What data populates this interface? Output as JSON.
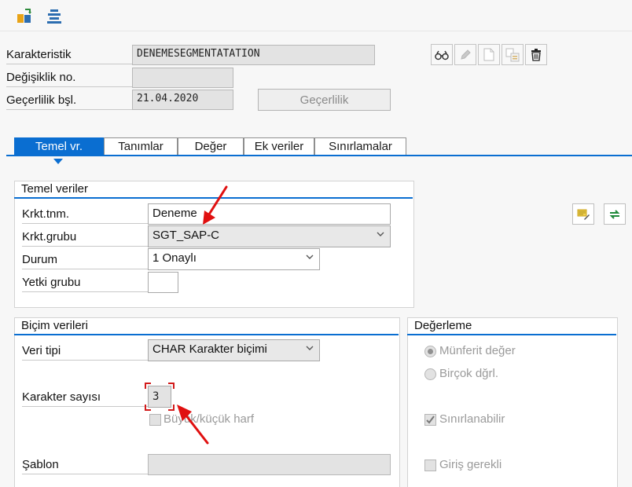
{
  "icons": {
    "toolbar": [
      "change-display-icon",
      "hierarchy-icon"
    ],
    "header_actions": [
      "display-icon",
      "edit-icon",
      "new-document-icon",
      "copy-icon",
      "delete-icon"
    ],
    "side": [
      "notes-icon",
      "refresh-icon"
    ]
  },
  "header": {
    "char_label": "Karakteristik",
    "char_value": "DENEMESEGMENTATATION",
    "change_no_label": "Değişiklik no.",
    "change_no_value": "",
    "valid_from_label": "Geçerlilik bşl.",
    "valid_from_value": "21.04.2020",
    "validity_button": "Geçerlilik"
  },
  "tabs": [
    {
      "label": "Temel vr.",
      "active": true
    },
    {
      "label": "Tanımlar",
      "active": false
    },
    {
      "label": "Değer",
      "active": false
    },
    {
      "label": "Ek veriler",
      "active": false
    },
    {
      "label": "Sınırlamalar",
      "active": false
    }
  ],
  "basic_data": {
    "title": "Temel veriler",
    "description_label": "Krkt.tnm.",
    "description_value": "Deneme",
    "group_label": "Krkt.grubu",
    "group_value": "SGT_SAP-C",
    "status_label": "Durum",
    "status_value": "1 Onaylı",
    "auth_group_label": "Yetki grubu",
    "auth_group_value": ""
  },
  "format_data": {
    "title": "Biçim verileri",
    "data_type_label": "Veri tipi",
    "data_type_value": "CHAR Karakter biçimi",
    "num_chars_label": "Karakter sayısı",
    "num_chars_value": "3",
    "case_sensitive_label": "Büyük/küçük harf",
    "case_sensitive_checked": false,
    "template_label": "Şablon",
    "template_value": ""
  },
  "value_assignment": {
    "title": "Değerleme",
    "single_value_label": "Münferit değer",
    "single_value_selected": true,
    "multiple_values_label": "Birçok dğrl.",
    "restrictable_label": "Sınırlanabilir",
    "restrictable_checked": true,
    "entry_required_label": "Giriş gerekli",
    "entry_required_checked": false
  },
  "colors": {
    "accent": "#0a6ed1",
    "annotation_arrow": "#e01010"
  }
}
